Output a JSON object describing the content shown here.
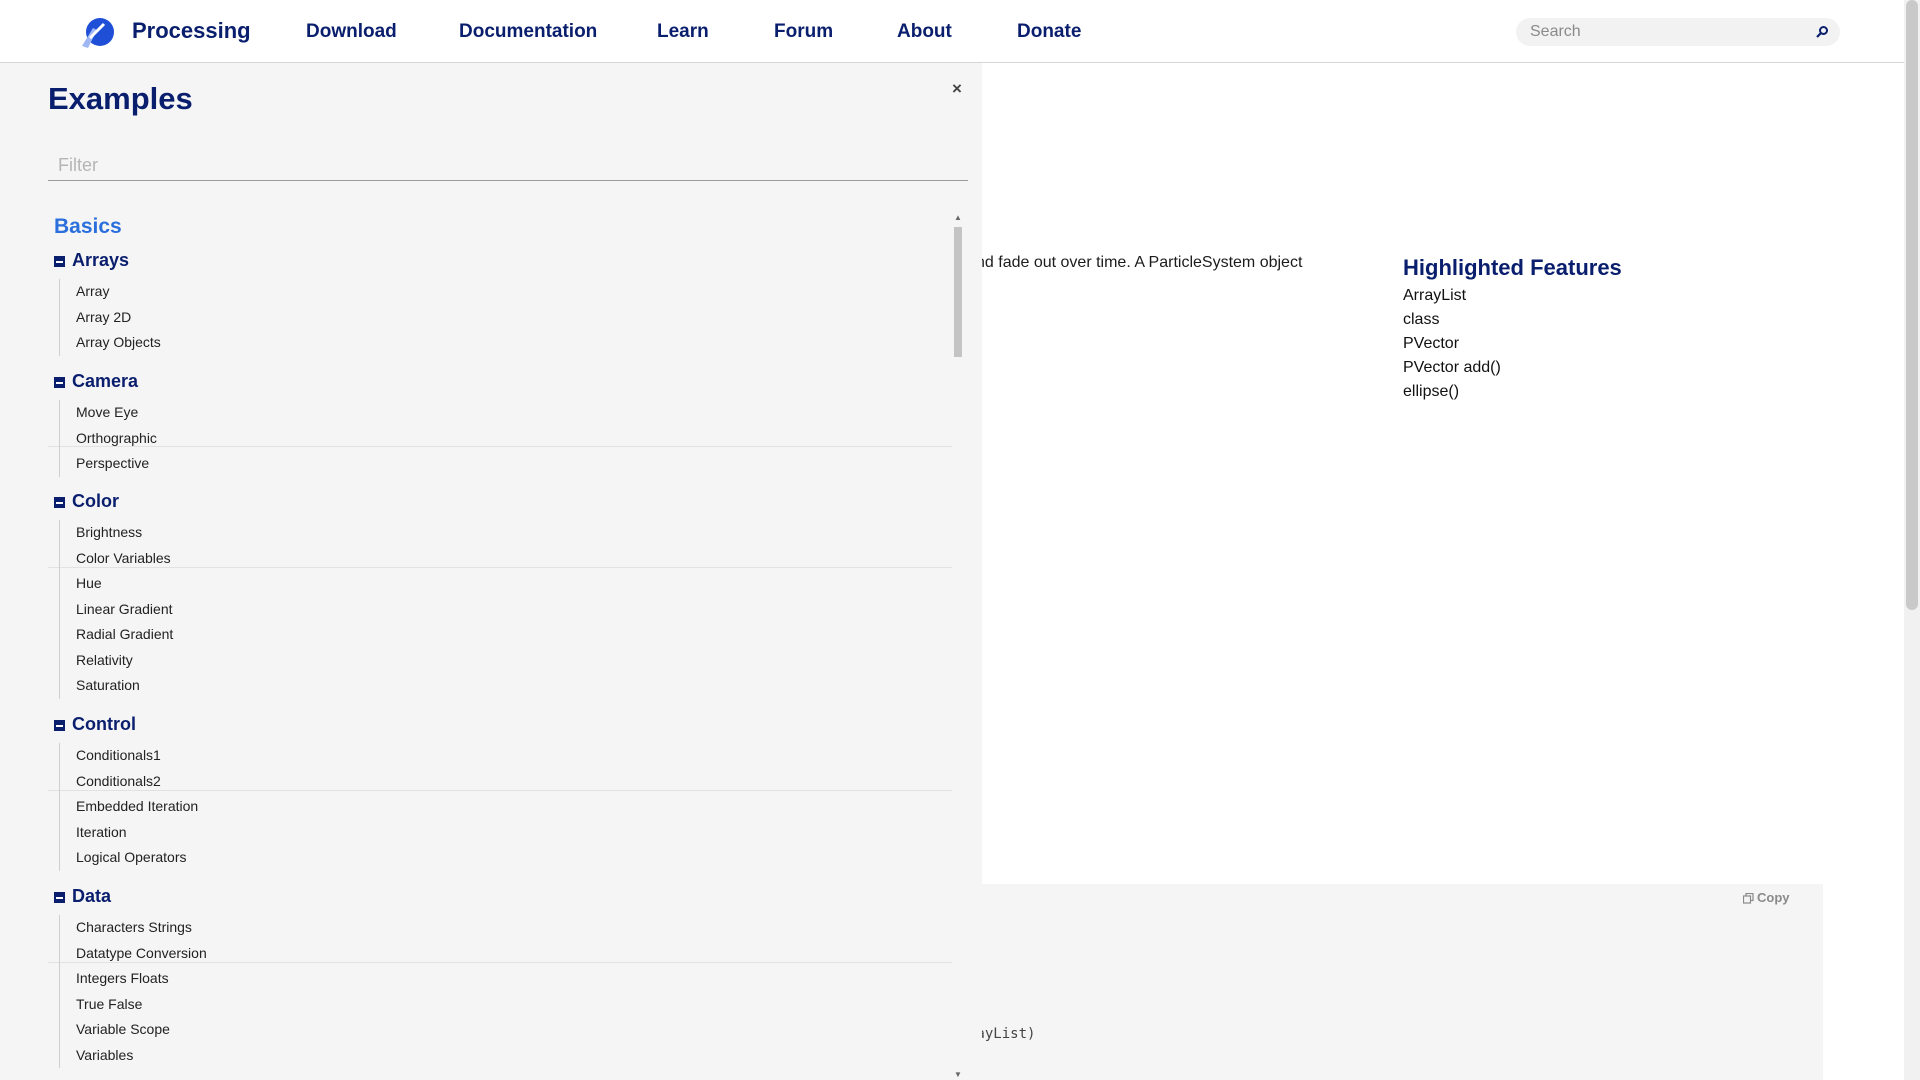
{
  "nav": {
    "brand": "Processing",
    "links": [
      "Download",
      "Documentation",
      "Learn",
      "Forum",
      "About",
      "Donate"
    ],
    "search_placeholder": "Search",
    "colors": {
      "brand_blue": "#0a1e6e",
      "accent_blue": "#2b6fdd"
    }
  },
  "background_page": {
    "description_fragment": "nd fade out over time. A ParticleSystem object",
    "features_title": "Highlighted Features",
    "features": [
      "ArrayList",
      "class",
      "PVector",
      "PVector add()",
      "ellipse()"
    ],
    "copy_label": "Copy",
    "code_fragment": "rayList)"
  },
  "drawer": {
    "title": "Examples",
    "close_label": "×",
    "filter_placeholder": "Filter",
    "category": "Basics",
    "groups": [
      {
        "label": "Arrays",
        "items": [
          "Array",
          "Array 2D",
          "Array Objects"
        ]
      },
      {
        "label": "Camera",
        "items": [
          "Move Eye",
          "Orthographic",
          "Perspective"
        ]
      },
      {
        "label": "Color",
        "items": [
          "Brightness",
          "Color Variables",
          "Hue",
          "Linear Gradient",
          "Radial Gradient",
          "Relativity",
          "Saturation"
        ]
      },
      {
        "label": "Control",
        "items": [
          "Conditionals1",
          "Conditionals2",
          "Embedded Iteration",
          "Iteration",
          "Logical Operators"
        ]
      },
      {
        "label": "Data",
        "items": [
          "Characters Strings",
          "Datatype Conversion",
          "Integers Floats",
          "True False",
          "Variable Scope",
          "Variables"
        ]
      }
    ]
  }
}
